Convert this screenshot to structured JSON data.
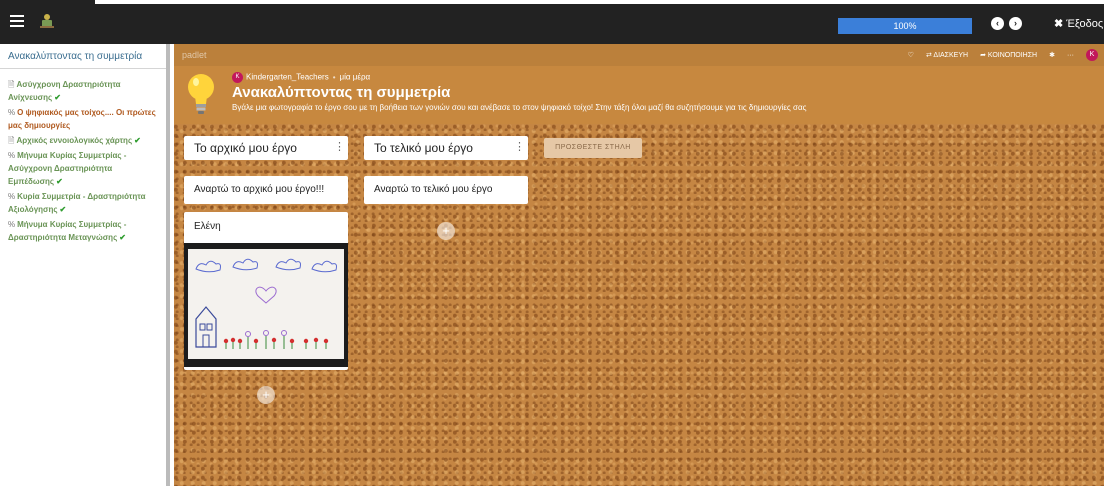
{
  "topbar": {
    "menu_icon": "hamburger-icon",
    "course_icon": "course-pictogram-icon",
    "progress_percent": 100,
    "progress_label": "100%",
    "nav_prev_icon": "chevron-left-circle-icon",
    "nav_next_icon": "chevron-right-circle-icon",
    "exit_label": "Έξοδος"
  },
  "sidebar": {
    "title": "Ανακαλύπτοντας τη συμμετρία",
    "items": [
      {
        "label": "Ασύγχρονη Δραστηριότητα Ανίχνευσης",
        "icon": "document-icon"
      },
      {
        "label": "Ο ψηφιακός μας τοίχος.... Οι πρώτες μας δημιουργίες",
        "icon": "link-icon"
      },
      {
        "label": "Αρχικός εννοιολογικός χάρτης",
        "icon": "document-icon"
      },
      {
        "label": "Μήνυμα Κυρίας Συμμετρίας - Ασύγχρονη Δραστηριότητα Εμπέδωσης",
        "icon": "link-icon"
      },
      {
        "label": "Κυρία Συμμετρία - Δραστηριότητα Αξιολόγησης",
        "icon": "link-icon"
      },
      {
        "label": "Μήνυμα Κυρίας Συμμετρίας - Δραστηριότητα Μεταγνώσης",
        "icon": "link-icon"
      }
    ],
    "check_glyph": "✔"
  },
  "padlet": {
    "logo": "padlet",
    "actions": {
      "remix_label": "ΔΙΑΣΚΕΥΗ",
      "share_label": "ΚΟΙΝΟΠΟΙΗΣΗ",
      "avatar_letter": "K"
    },
    "author": {
      "avatar_letter": "K",
      "name": "Kindergarten_Teachers",
      "separator": "•",
      "time": "μία μέρα"
    },
    "title": "Ανακαλύπτοντας τη συμμετρία",
    "description": "Βγάλε μια φωτογραφία το έργο σου με τη βοήθεια των γονιών σου και ανέβασε το στον ψηφιακό τοίχο! Στην τάξη όλοι μαζί θα συζητήσουμε για τις δημιουργίες σας",
    "columns": [
      {
        "title": "Το αρχικό μου έργο",
        "menu": "⋮",
        "posts": [
          "Αναρτώ το αρχικό μου έργο!!!",
          "Ελένη"
        ]
      },
      {
        "title": "Το τελικό μου έργο",
        "menu": "⋮",
        "posts": [
          "Αναρτώ το τελικό μου έργο"
        ]
      }
    ],
    "add_column_label": "ΠΡΟΣΘΕΣΤΕ ΣΤΗΛΗ",
    "add_post_glyph": "+",
    "colors": {
      "accent": "#c7883f",
      "avatar": "#c2185b",
      "progress": "#3b7fd9"
    }
  }
}
